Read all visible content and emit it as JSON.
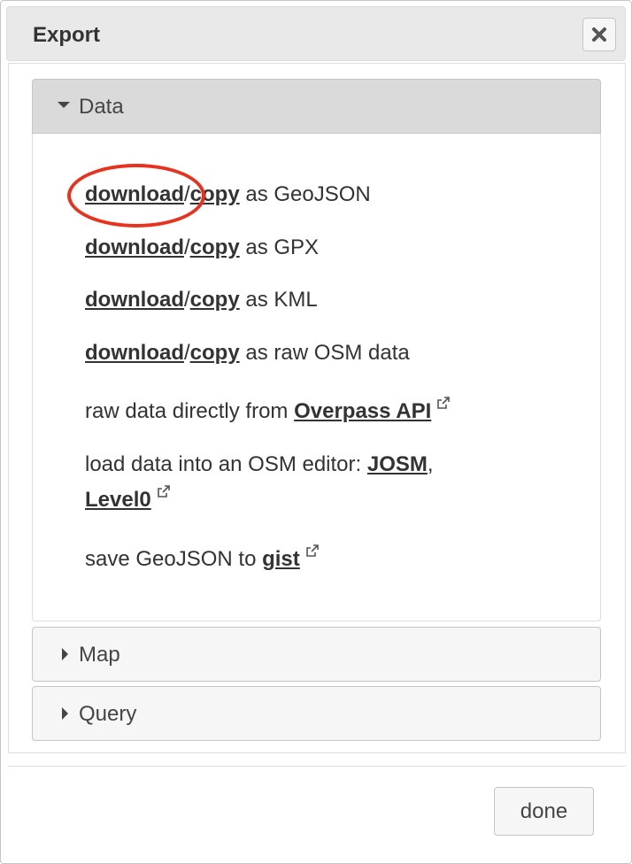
{
  "dialog": {
    "title": "Export",
    "close_icon": "close-x-icon",
    "done_label": "done"
  },
  "sections": {
    "data": {
      "label": "Data",
      "expanded": true
    },
    "map": {
      "label": "Map",
      "expanded": false
    },
    "query": {
      "label": "Query",
      "expanded": false
    }
  },
  "data_panel": {
    "geojson": {
      "download": "download",
      "sep": "/",
      "copy": "copy",
      "suffix": " as GeoJSON"
    },
    "gpx": {
      "download": "download",
      "sep": "/",
      "copy": "copy",
      "suffix": " as GPX"
    },
    "kml": {
      "download": "download",
      "sep": "/",
      "copy": "copy",
      "suffix": " as KML"
    },
    "osm": {
      "download": "download",
      "sep": "/",
      "copy": "copy",
      "suffix": " as raw OSM data"
    },
    "overpass": {
      "prefix": "raw data directly from ",
      "link": "Overpass API"
    },
    "editor": {
      "prefix": "load data into an OSM editor: ",
      "josm": "JOSM",
      "comma": ",",
      "level0": "Level0"
    },
    "gist": {
      "prefix": "save GeoJSON to ",
      "link": "gist"
    }
  },
  "annotation": {
    "color": "#e8321e",
    "target": "download (GeoJSON)"
  }
}
